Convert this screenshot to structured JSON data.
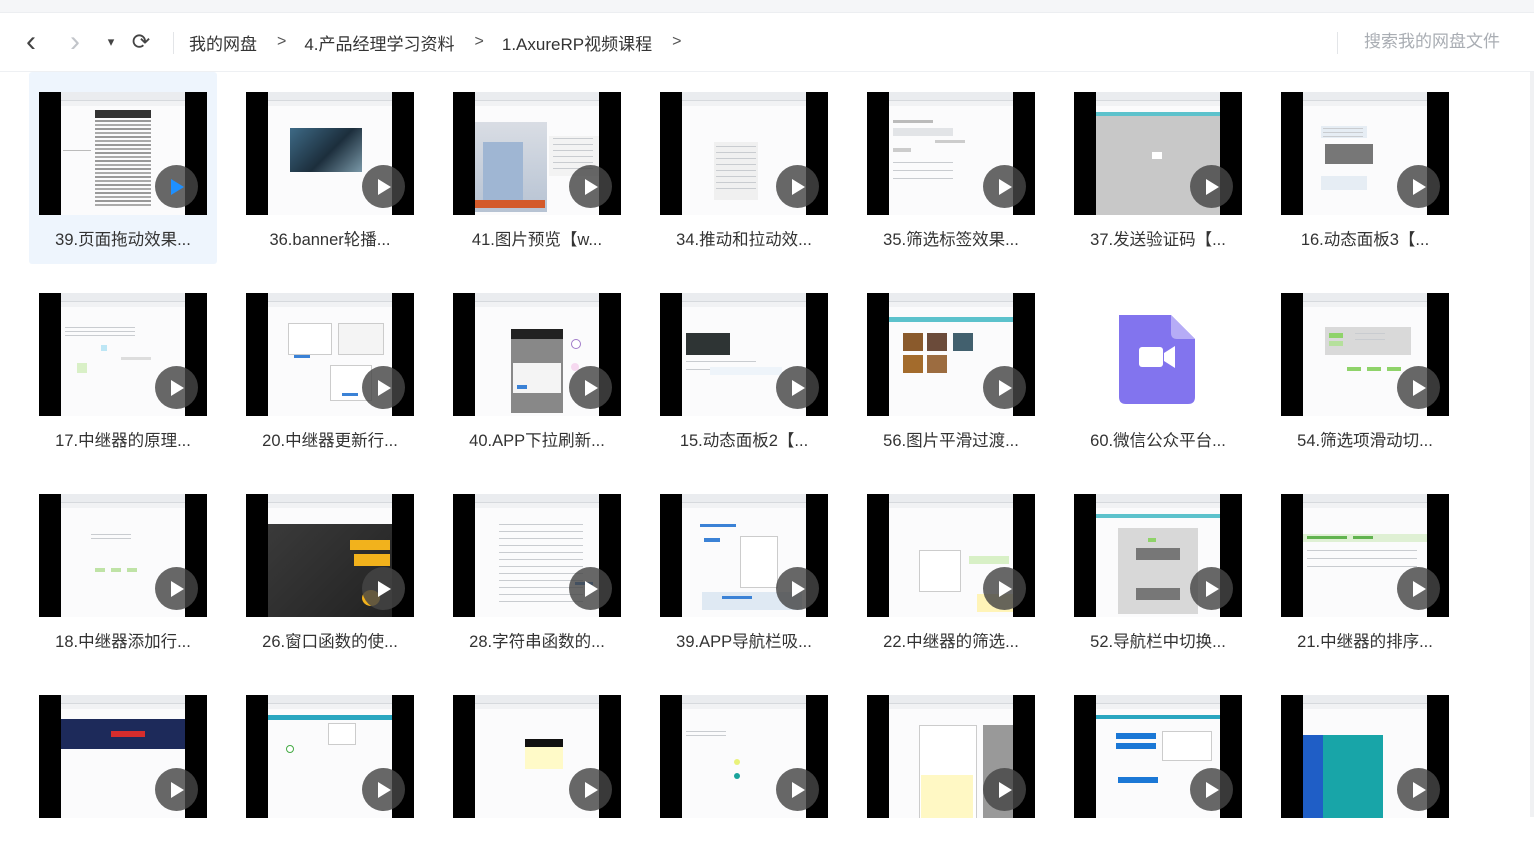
{
  "toolbar": {
    "back_glyph": "‹",
    "forward_glyph": "›",
    "menu_glyph": "▾",
    "refresh_glyph": "⟳",
    "breadcrumb": [
      "我的网盘",
      "4.产品经理学习资料",
      "1.AxureRP视频课程"
    ],
    "crumb_separator": ">",
    "search_placeholder": "搜索我的网盘文件"
  },
  "icons": {
    "back": "chevron-left-icon",
    "forward": "chevron-right-icon",
    "dropdown": "caret-down-icon",
    "refresh": "refresh-icon",
    "play": "play-icon",
    "video_file": "video-file-icon"
  },
  "colors": {
    "selected_tile_bg": "#eef5fd",
    "selected_play_accent": "#1e90ff",
    "video_file_icon": "#8274ee"
  },
  "files": [
    {
      "name": "39.页面拖动效果...",
      "selected": true,
      "style": "text"
    },
    {
      "name": "36.banner轮播...",
      "style": "photo"
    },
    {
      "name": "41.图片预览【w...",
      "style": "girl"
    },
    {
      "name": "34.推动和拉动效...",
      "style": "table"
    },
    {
      "name": "35.筛选标签效果...",
      "style": "form"
    },
    {
      "name": "37.发送验证码【...",
      "style": "gray"
    },
    {
      "name": "16.动态面板3【...",
      "style": "panel"
    },
    {
      "name": "17.中继器的原理...",
      "style": "sketch"
    },
    {
      "name": "20.中继器更新行...",
      "style": "forms"
    },
    {
      "name": "40.APP下拉刷新...",
      "style": "app"
    },
    {
      "name": "15.动态面板2【...",
      "style": "dark"
    },
    {
      "name": "56.图片平滑过渡...",
      "style": "photos"
    },
    {
      "name": "60.微信公众平台...",
      "style": "videofile"
    },
    {
      "name": "54.筛选项滑动切...",
      "style": "slider"
    },
    {
      "name": "18.中继器添加行...",
      "style": "sketch2"
    },
    {
      "name": "26.窗口函数的使...",
      "style": "poster"
    },
    {
      "name": "28.字符串函数的...",
      "style": "doc"
    },
    {
      "name": "39.APP导航栏吸...",
      "style": "nav"
    },
    {
      "name": "22.中继器的筛选...",
      "style": "filter"
    },
    {
      "name": "52.导航栏中切换...",
      "style": "gray2"
    },
    {
      "name": "21.中继器的排序...",
      "style": "sort"
    },
    {
      "name": "",
      "style": "darkbanner"
    },
    {
      "name": "",
      "style": "teal"
    },
    {
      "name": "",
      "style": "yellow"
    },
    {
      "name": "",
      "style": "dot"
    },
    {
      "name": "",
      "style": "yellowpanel"
    },
    {
      "name": "",
      "style": "bluebtns"
    },
    {
      "name": "",
      "style": "tealblue"
    }
  ]
}
